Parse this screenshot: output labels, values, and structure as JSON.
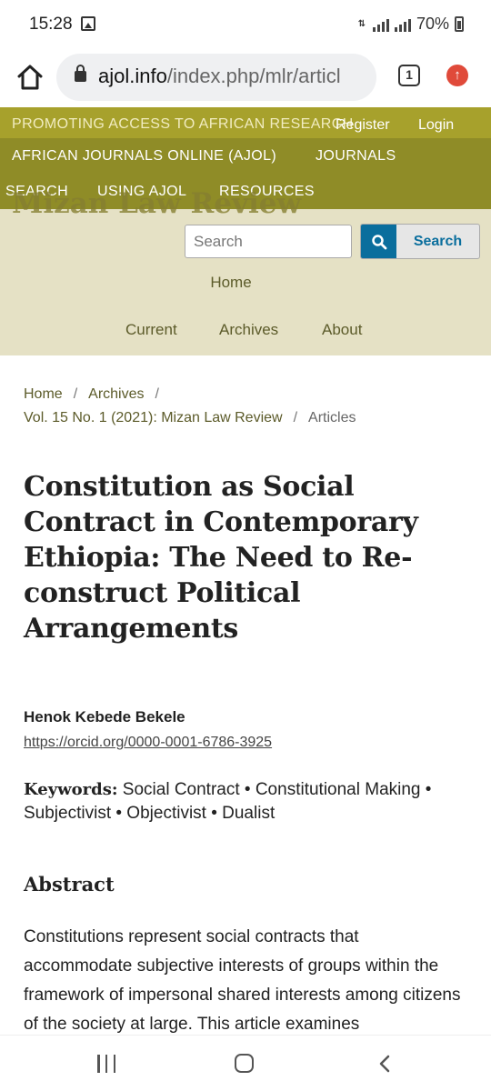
{
  "status_bar": {
    "time": "15:28",
    "battery": "70%",
    "icons": [
      "gallery-icon",
      "data-arrows-icon",
      "signal-icon",
      "signal-icon",
      "battery-icon"
    ]
  },
  "browser": {
    "url_host": "ajol.info",
    "url_path": "/index.php/mlr/articl",
    "tab_count": "1",
    "icons": [
      "home-icon",
      "lock-icon",
      "tabs-icon",
      "update-icon"
    ]
  },
  "ajol": {
    "promo": "PROMOTING ACCESS TO AFRICAN RESEARCH",
    "register": "Register",
    "login": "Login",
    "main_link": "AFRICAN JOURNALS ONLINE (AJOL)",
    "journals": "JOURNALS",
    "search": "SEARCH",
    "using": "USING AJOL",
    "resources": "RESOURCES"
  },
  "journal": {
    "title": "Mizan Law Review",
    "search_placeholder": "Search",
    "search_button": "Search",
    "nav": {
      "home": "Home",
      "current": "Current",
      "archives": "Archives",
      "about": "About"
    }
  },
  "breadcrumb": {
    "home": "Home",
    "archives": "Archives",
    "issue": "Vol. 15 No. 1 (2021): Mizan Law Review",
    "current": "Articles",
    "separator": "/"
  },
  "article": {
    "title": "Constitution as Social Contract in Contemporary Ethiopia: The Need to Re-construct Political Arrangements",
    "author": "Henok Kebede Bekele",
    "orcid": "https://orcid.org/0000-0001-6786-3925",
    "keywords_label": "Keywords:",
    "keywords": "Social Contract • Constitutional Making • Subjectivist • Objectivist • Dualist",
    "abstract_heading": "Abstract",
    "abstract_text": "Constitutions represent social contracts that accommodate subjective interests of groups within the framework of impersonal shared interests among citizens of the society at large.  This article examines"
  },
  "colors": {
    "ajol_olive": "#8f8c27",
    "journal_header_bg": "#e5e1c5",
    "search_blue": "#0a6e9d",
    "update_red": "#e04a3a"
  }
}
